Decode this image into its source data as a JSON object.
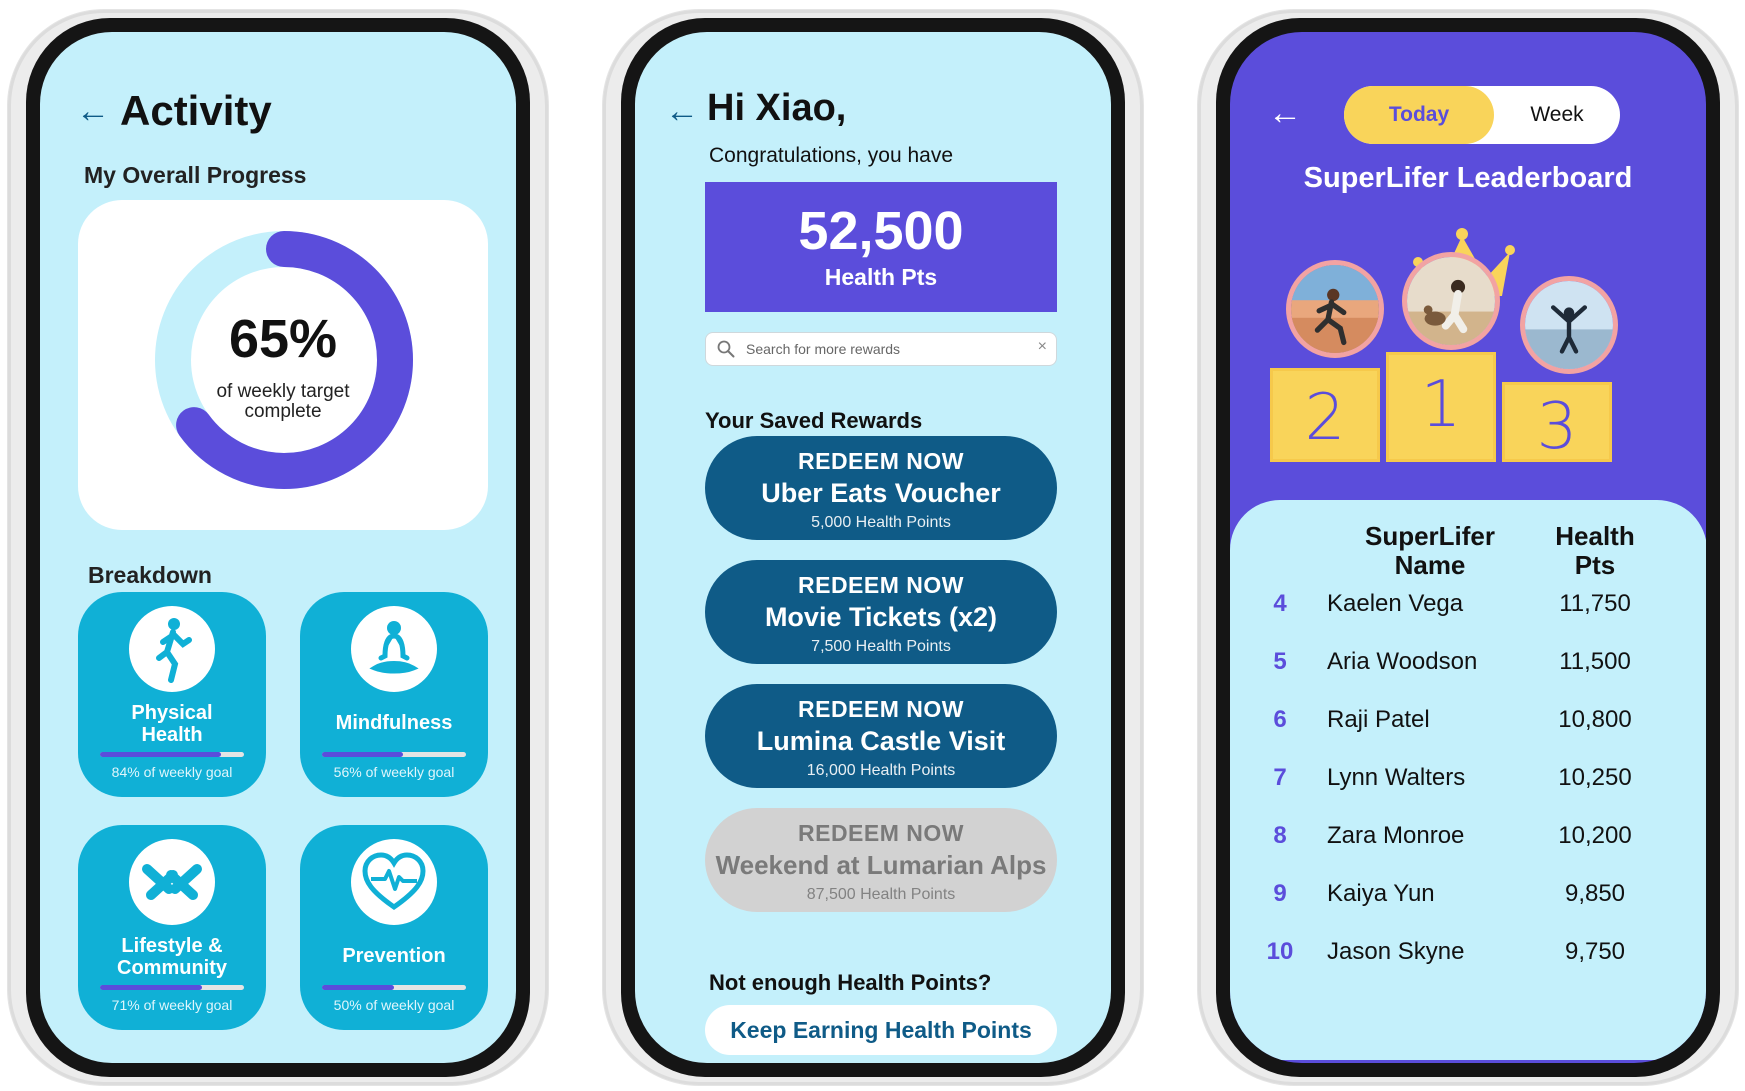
{
  "colors": {
    "screen_bg": "#c4f0fb",
    "accent_purple": "#5b4ddb",
    "tile_blue": "#10b0d6",
    "reward_navy": "#0f5b87",
    "yellow": "#f9d45a",
    "disabled_grey": "#d2d2d2"
  },
  "activity": {
    "back_icon": "arrow-left-icon",
    "title": "Activity",
    "overall_label": "My Overall Progress",
    "overall_progress": 0.65,
    "percent_text": "65%",
    "percent_caption_line1": "of weekly target",
    "percent_caption_line2": "complete",
    "breakdown_label": "Breakdown",
    "tiles": [
      {
        "icon": "runner-icon",
        "label_line1": "Physical",
        "label_line2": "Health",
        "progress": 0.84,
        "goal_text": "84% of weekly goal"
      },
      {
        "icon": "meditation-icon",
        "label_line1": "Mindfulness",
        "label_line2": "",
        "progress": 0.56,
        "goal_text": "56% of weekly goal"
      },
      {
        "icon": "community-hands-icon",
        "label_line1": "Lifestyle &",
        "label_line2": "Community",
        "progress": 0.71,
        "goal_text": "71% of weekly goal"
      },
      {
        "icon": "heart-pulse-icon",
        "label_line1": "Prevention",
        "label_line2": "",
        "progress": 0.5,
        "goal_text": "50% of weekly goal"
      }
    ]
  },
  "rewards": {
    "back_icon": "arrow-left-icon",
    "greeting": "Hi Xiao,",
    "congrats": "Congratulations, you have",
    "points_value": "52,500",
    "points_label": "Health Pts",
    "search_placeholder": "Search for more rewards",
    "search_icon": "search-icon",
    "clear_icon": "close-icon",
    "clear_glyph": "×",
    "saved_label": "Your Saved Rewards",
    "items": [
      {
        "action": "REDEEM NOW",
        "name": "Uber Eats Voucher",
        "cost": "5,000 Health Points",
        "enabled": true
      },
      {
        "action": "REDEEM NOW",
        "name": "Movie Tickets (x2)",
        "cost": "7,500 Health Points",
        "enabled": true
      },
      {
        "action": "REDEEM NOW",
        "name": "Lumina Castle Visit",
        "cost": "16,000 Health Points",
        "enabled": true
      },
      {
        "action": "REDEEM NOW",
        "name": "Weekend at Lumarian Alps",
        "cost": "87,500 Health Points",
        "enabled": false
      }
    ],
    "not_enough": "Not enough Health Points?",
    "keep_earning": "Keep Earning Health Points"
  },
  "leaderboard": {
    "back_icon": "arrow-left-icon",
    "tab_today": "Today",
    "tab_week": "Week",
    "title": "SuperLifer Leaderboard",
    "podium": [
      "2",
      "1",
      "3"
    ],
    "header_name_line1": "SuperLifer",
    "header_name_line2": "Name",
    "header_pts_line1": "Health",
    "header_pts_line2": "Pts",
    "rows": [
      {
        "rank": "4",
        "name": "Kaelen Vega",
        "pts": "11,750"
      },
      {
        "rank": "5",
        "name": "Aria Woodson",
        "pts": "11,500"
      },
      {
        "rank": "6",
        "name": "Raji Patel",
        "pts": "10,800"
      },
      {
        "rank": "7",
        "name": "Lynn Walters",
        "pts": "10,250"
      },
      {
        "rank": "8",
        "name": "Zara Monroe",
        "pts": "10,200"
      },
      {
        "rank": "9",
        "name": "Kaiya Yun",
        "pts": "9,850"
      },
      {
        "rank": "10",
        "name": "Jason Skyne",
        "pts": "9,750"
      }
    ]
  }
}
